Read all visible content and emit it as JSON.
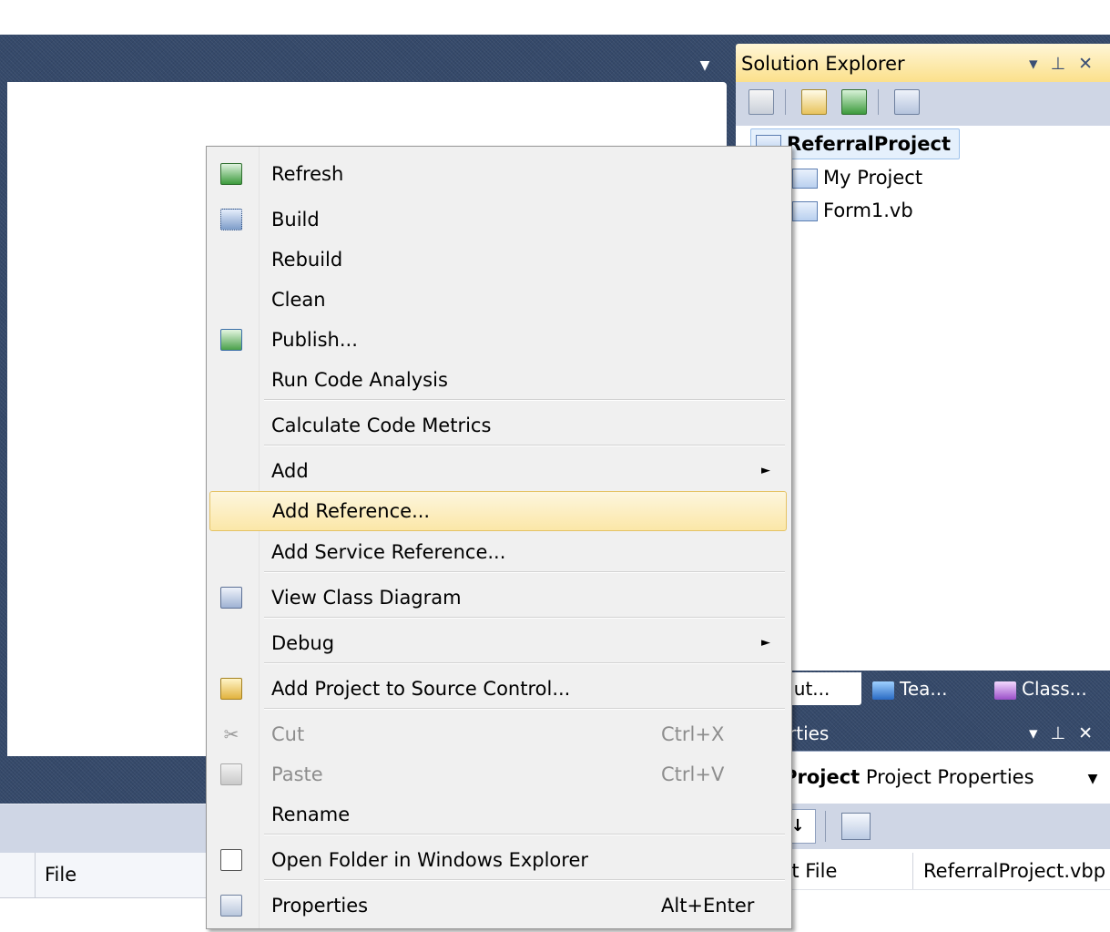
{
  "solution_explorer": {
    "title": "Solution Explorer",
    "title_controls": "▾ ⊥ ✕",
    "tree": {
      "root": "ReferralProject",
      "children": [
        "My Project",
        "Form1.vb"
      ]
    },
    "tabs": [
      "olut...",
      "Tea...",
      "Class..."
    ]
  },
  "properties": {
    "title": "rties",
    "title_controls": "▾ ⊥ ✕",
    "object_name": "rralProject",
    "object_type": "Project Properties",
    "row_key": "roject File",
    "row_value": "ReferralProject.vbp"
  },
  "bottom_panel": {
    "column_file": "File"
  },
  "context_menu": {
    "items": [
      {
        "label": "Refresh",
        "shortcut": "",
        "icon": "refresh-icon"
      },
      {
        "label": "Build",
        "shortcut": "",
        "icon": "build-icon"
      },
      {
        "label": "Rebuild",
        "shortcut": "",
        "icon": ""
      },
      {
        "label": "Clean",
        "shortcut": "",
        "icon": ""
      },
      {
        "label": "Publish...",
        "shortcut": "",
        "icon": "publish-icon"
      },
      {
        "label": "Run Code Analysis",
        "shortcut": "",
        "icon": ""
      },
      {
        "label": "Calculate Code Metrics",
        "shortcut": "",
        "icon": ""
      },
      {
        "label": "Add",
        "shortcut": "",
        "icon": "",
        "submenu": true
      },
      {
        "label": "Add Reference...",
        "shortcut": "",
        "icon": "",
        "highlighted": true
      },
      {
        "label": "Add Service Reference...",
        "shortcut": "",
        "icon": ""
      },
      {
        "label": "View Class Diagram",
        "shortcut": "",
        "icon": "class-diagram-icon"
      },
      {
        "label": "Debug",
        "shortcut": "",
        "icon": "",
        "submenu": true
      },
      {
        "label": "Add Project to Source Control...",
        "shortcut": "",
        "icon": "source-control-icon"
      },
      {
        "label": "Cut",
        "shortcut": "Ctrl+X",
        "icon": "cut-icon",
        "disabled": true
      },
      {
        "label": "Paste",
        "shortcut": "Ctrl+V",
        "icon": "paste-icon",
        "disabled": true
      },
      {
        "label": "Rename",
        "shortcut": "",
        "icon": ""
      },
      {
        "label": "Open Folder in Windows Explorer",
        "shortcut": "",
        "icon": "open-folder-icon"
      },
      {
        "label": "Properties",
        "shortcut": "Alt+Enter",
        "icon": "properties-icon"
      }
    ],
    "submenu_arrow": "►"
  },
  "doc_well": {
    "dropdown_glyph": "▼"
  },
  "colors": {
    "ide_background": "#35496a",
    "menu_highlight": "#fbe7a8",
    "se_title_active": "#fbe08b"
  }
}
